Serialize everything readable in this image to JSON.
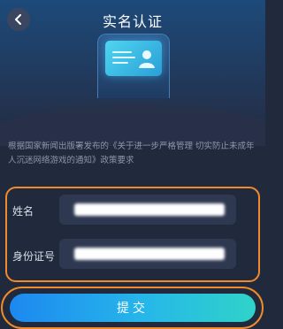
{
  "header": {
    "title": "实名认证",
    "back_icon": "chevron-left-icon"
  },
  "illustration": {
    "icon": "id-card-icon",
    "accent": "#4fd5f0"
  },
  "notice": "根据国家新闻出版署发布的《关于进一步严格管理 切实防止未成年人沉迷网络游戏的通知》政策要求",
  "form": {
    "name_label": "姓名",
    "id_label": "身份证号"
  },
  "submit_label": "提交",
  "colors": {
    "background": "#202a3c",
    "field": "#2e3850",
    "highlight": "#f08a2c",
    "button_start": "#1d88f0",
    "button_end": "#2fd3c9"
  }
}
